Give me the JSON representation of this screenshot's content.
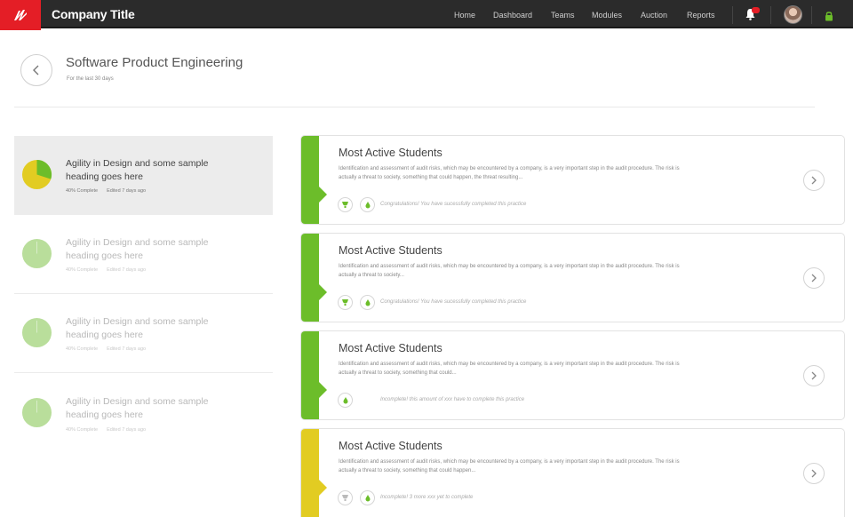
{
  "header": {
    "company_title": "Company Title",
    "nav": [
      "Home",
      "Dashboard",
      "Teams",
      "Modules",
      "Auction",
      "Reports"
    ]
  },
  "page": {
    "title": "Software Product Engineering",
    "subtitle": "For the last 30 days"
  },
  "left_items": [
    {
      "title": "Agility in Design and some sample heading goes here",
      "progress": "40% Complete",
      "time": "Edited 7 days ago",
      "progress_value": 0.4
    },
    {
      "title": "Agility in Design and some sample heading goes here",
      "progress": "40% Complete",
      "time": "Edited 7 days ago",
      "progress_value": 0.0
    },
    {
      "title": "Agility in Design and some sample heading goes here",
      "progress": "40% Complete",
      "time": "Edited 7 days ago",
      "progress_value": 0.0
    },
    {
      "title": "Agility in Design and some sample heading goes here",
      "progress": "40% Complete",
      "time": "Edited 7 days ago",
      "progress_value": 0.0
    }
  ],
  "cards": [
    {
      "title": "Most Active Students",
      "desc": "Identification and assessment of audit risks, which may be encountered by a company, is a very important step in the audit procedure. The risk is actually a threat to society, something that could happen, the threat resulting...",
      "message": "Congratulations! You have sucessfully completed this practice",
      "accent": "#6cbd2a"
    },
    {
      "title": "Most Active Students",
      "desc": "Identification and assessment of audit risks, which may be encountered by a company, is a very important step in the audit procedure. The risk is actually a threat to society...",
      "message": "Congratulations! You have sucessfully completed this practice",
      "accent": "#6cbd2a"
    },
    {
      "title": "Most Active Students",
      "desc": "Identification and assessment of audit risks, which may be encountered by a company, is a very important step in the audit procedure. The risk is actually a threat to society, something that could...",
      "message": "Incomplete! this amount of xxx have to complete this practice",
      "accent": "#6cbd2a"
    },
    {
      "title": "Most Active Students",
      "desc": "Identification and assessment of audit risks, which may be encountered by a company, is a very important step in the audit procedure. The risk is actually a threat to society, something that could happen...",
      "message": "Incomplete! 3 more xxx yet to complete",
      "accent": "#e2cc22"
    }
  ],
  "colors": {
    "brand": "#e41e26",
    "topbar": "#2b2b2b",
    "green": "#6cbd2a",
    "yellow": "#e2cc22",
    "pale_green": "#b9de9b"
  },
  "icons": {
    "logo": "brand-logo-icon",
    "bell": "bell-icon",
    "lock": "lock-icon",
    "back": "chevron-left-icon",
    "arrow": "chevron-right-icon",
    "badge": "trophy-icon",
    "drop": "drop-icon"
  }
}
